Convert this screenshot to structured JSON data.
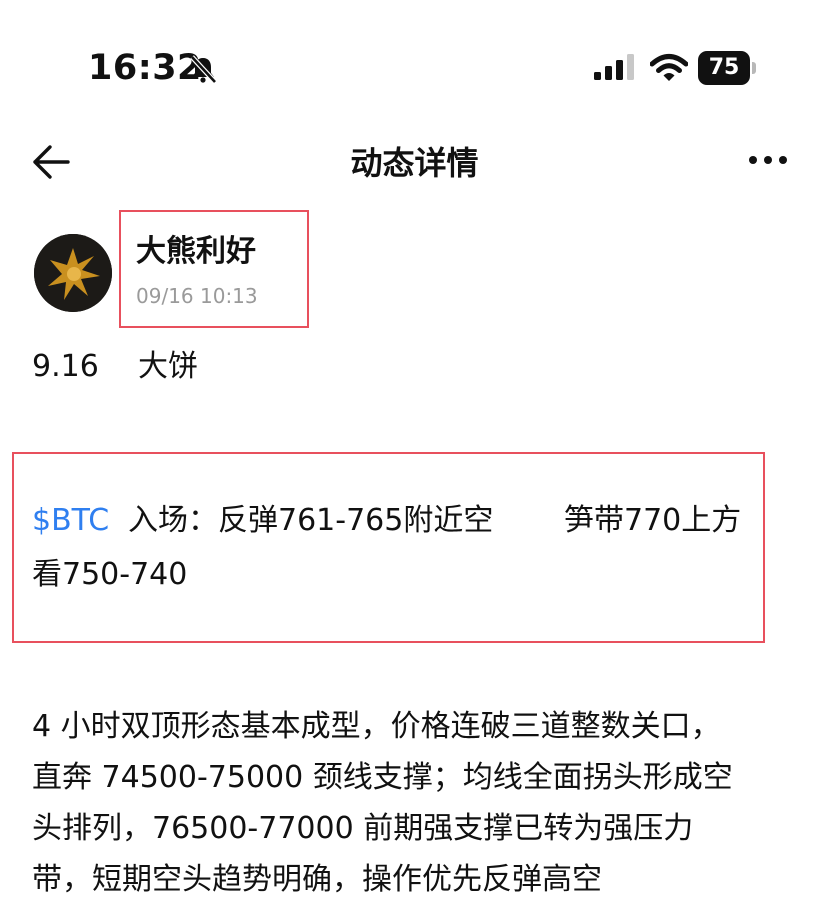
{
  "status_bar": {
    "time": "16:32",
    "battery": "75"
  },
  "nav": {
    "title": "动态详情"
  },
  "post": {
    "author": "大熊利好",
    "date": "09/16 10:13",
    "heading_date": "9.16",
    "heading_text": "大饼",
    "ticker": "$BTC",
    "entry_line1": "入场：反弹761-765附近空",
    "entry_line1b": "笋带770上方",
    "entry_line2": "看750-740",
    "body_lines": [
      "4 小时双顶形态基本成型，价格连破三道整数关口，",
      "直奔 74500-75000 颈线支撑；均线全面拐头形成空",
      "头排列，76500-77000 前期强支撑已转为强压力",
      "带，短期空头趋势明确，操作优先反弹高空"
    ]
  },
  "colors": {
    "highlight": "#e8505d",
    "ticker": "#2f7ff0",
    "date": "#9a9a9a"
  }
}
